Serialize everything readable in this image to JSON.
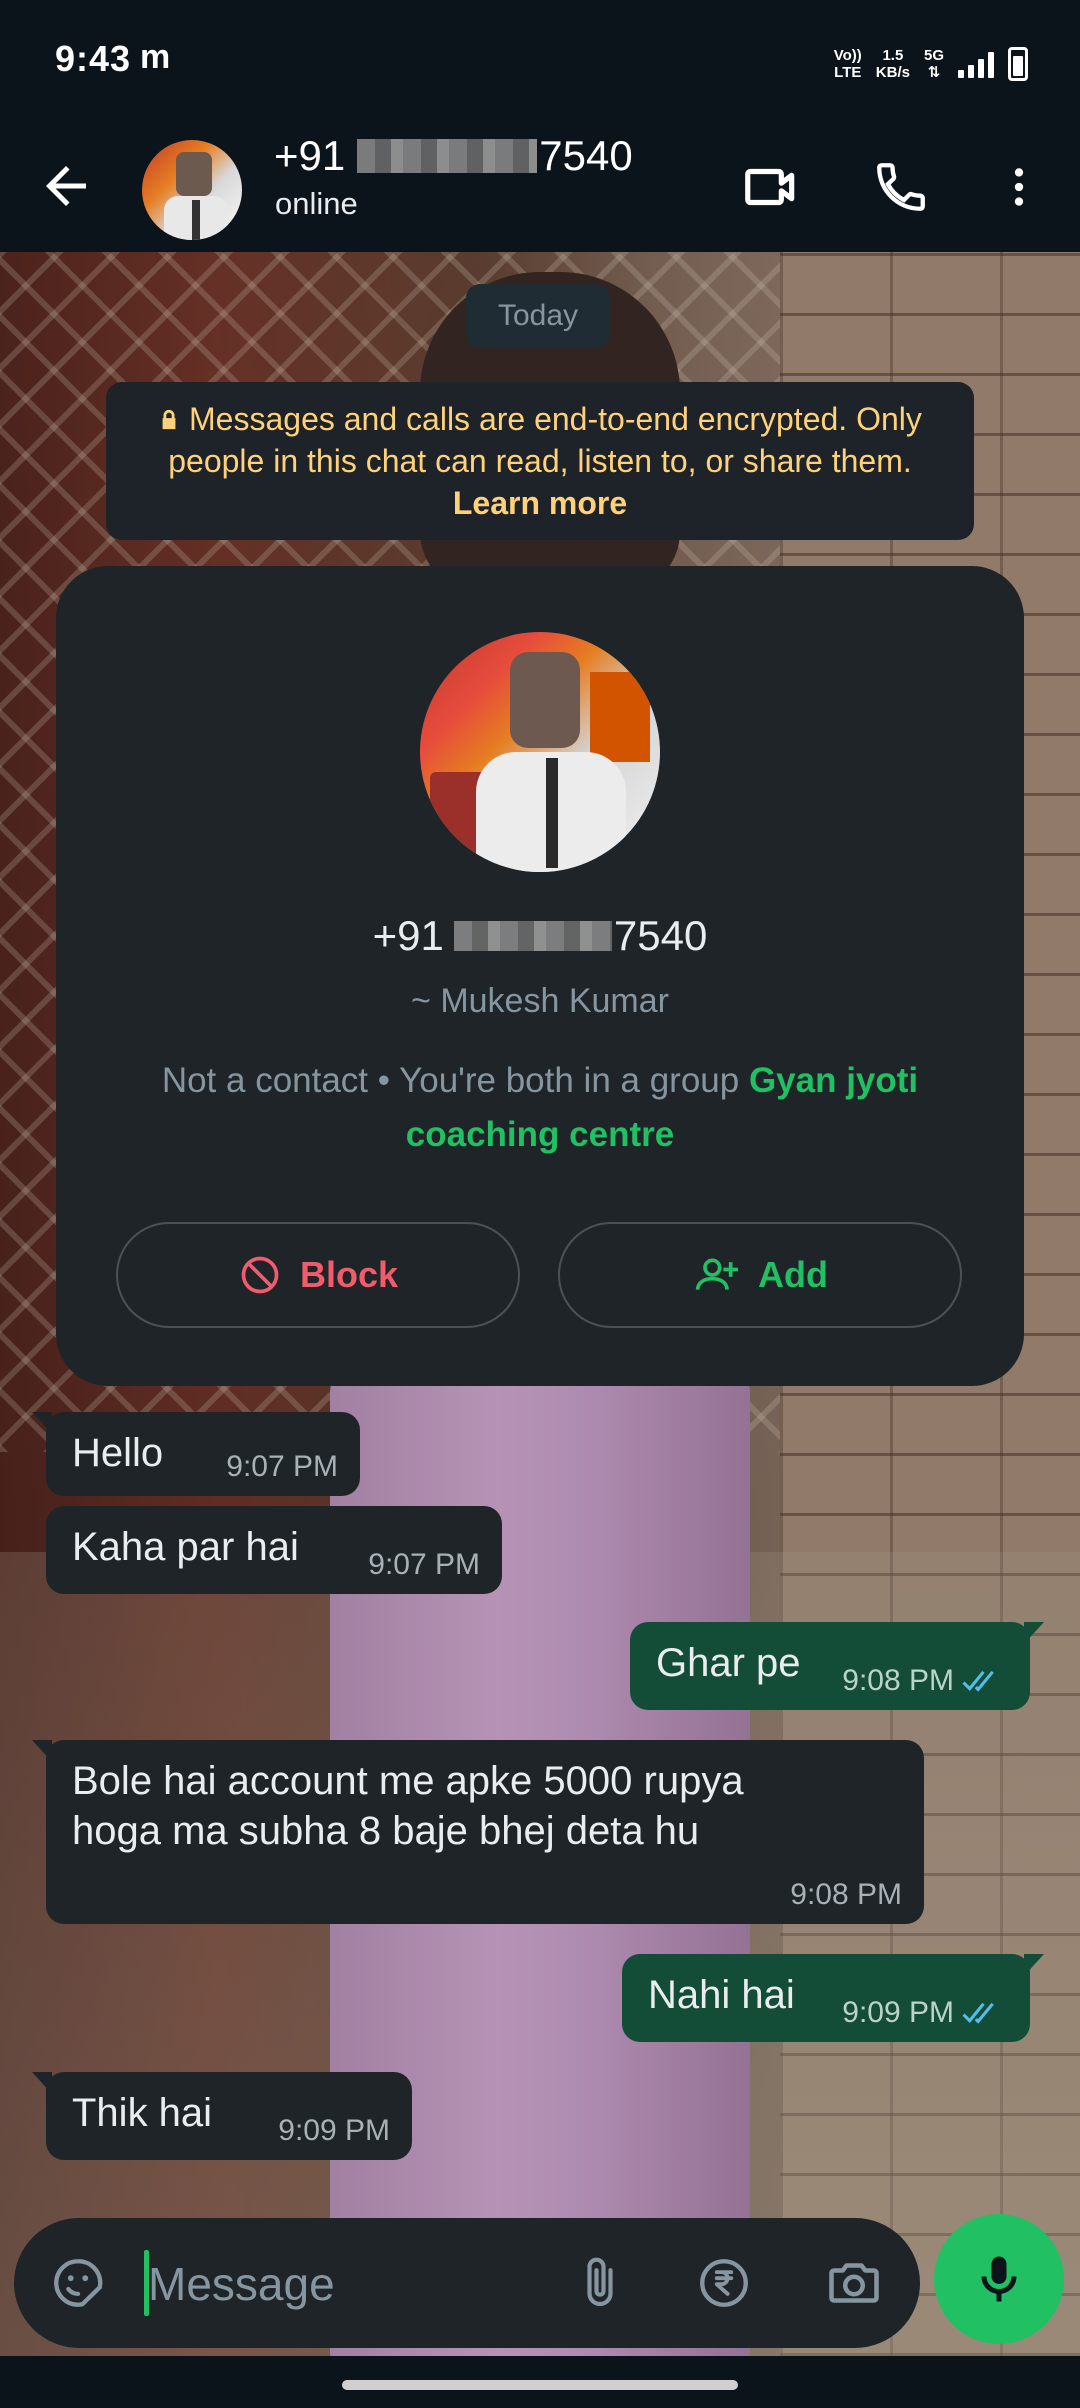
{
  "status_bar": {
    "time": "9:43",
    "notification": "m",
    "volte_top": "Vo))",
    "volte_bottom": "LTE",
    "speed_top": "1.5",
    "speed_bottom": "KB/s",
    "network": "5G"
  },
  "header": {
    "phone_prefix": "+91",
    "phone_suffix": "7540",
    "status": "online"
  },
  "chat": {
    "date_chip": "Today",
    "encryption_text": "Messages and calls are end-to-end encrypted. Only people in this chat can read, listen to, or share them.",
    "encryption_link": "Learn more",
    "contact_card": {
      "phone_prefix": "+91",
      "phone_suffix": "7540",
      "push_name": "~ Mukesh Kumar",
      "group_prefix": "Not a contact • You're both in a group",
      "group_name": "Gyan jyoti coaching centre",
      "block_label": "Block",
      "add_label": "Add"
    },
    "messages": [
      {
        "direction": "in",
        "text": "Hello",
        "time": "9:07 PM"
      },
      {
        "direction": "in",
        "text": "Kaha par hai",
        "time": "9:07 PM"
      },
      {
        "direction": "out",
        "text": "Ghar pe",
        "time": "9:08 PM",
        "read": true
      },
      {
        "direction": "in",
        "text": "Bole hai account me apke 5000 rupya hoga ma subha 8 baje bhej deta hu",
        "time": "9:08 PM"
      },
      {
        "direction": "out",
        "text": "Nahi hai",
        "time": "9:09 PM",
        "read": true
      },
      {
        "direction": "in",
        "text": "Thik hai",
        "time": "9:09 PM"
      }
    ]
  },
  "composer": {
    "placeholder": "Message"
  },
  "colors": {
    "accent": "#21c063",
    "incoming_bubble": "#1f2428",
    "outgoing_bubble": "#134d37",
    "read_ticks": "#53bdeb",
    "block_red": "#f15c6d",
    "encryption_yellow": "#ffd279"
  },
  "icons": {
    "back": "arrow-left-icon",
    "video": "video-call-icon",
    "call": "phone-icon",
    "menu": "more-vertical-icon",
    "lock": "lock-icon",
    "block": "block-icon",
    "add": "add-person-icon",
    "sticker": "sticker-icon",
    "attach": "paperclip-icon",
    "payment": "rupee-icon",
    "camera": "camera-icon",
    "mic": "microphone-icon"
  }
}
